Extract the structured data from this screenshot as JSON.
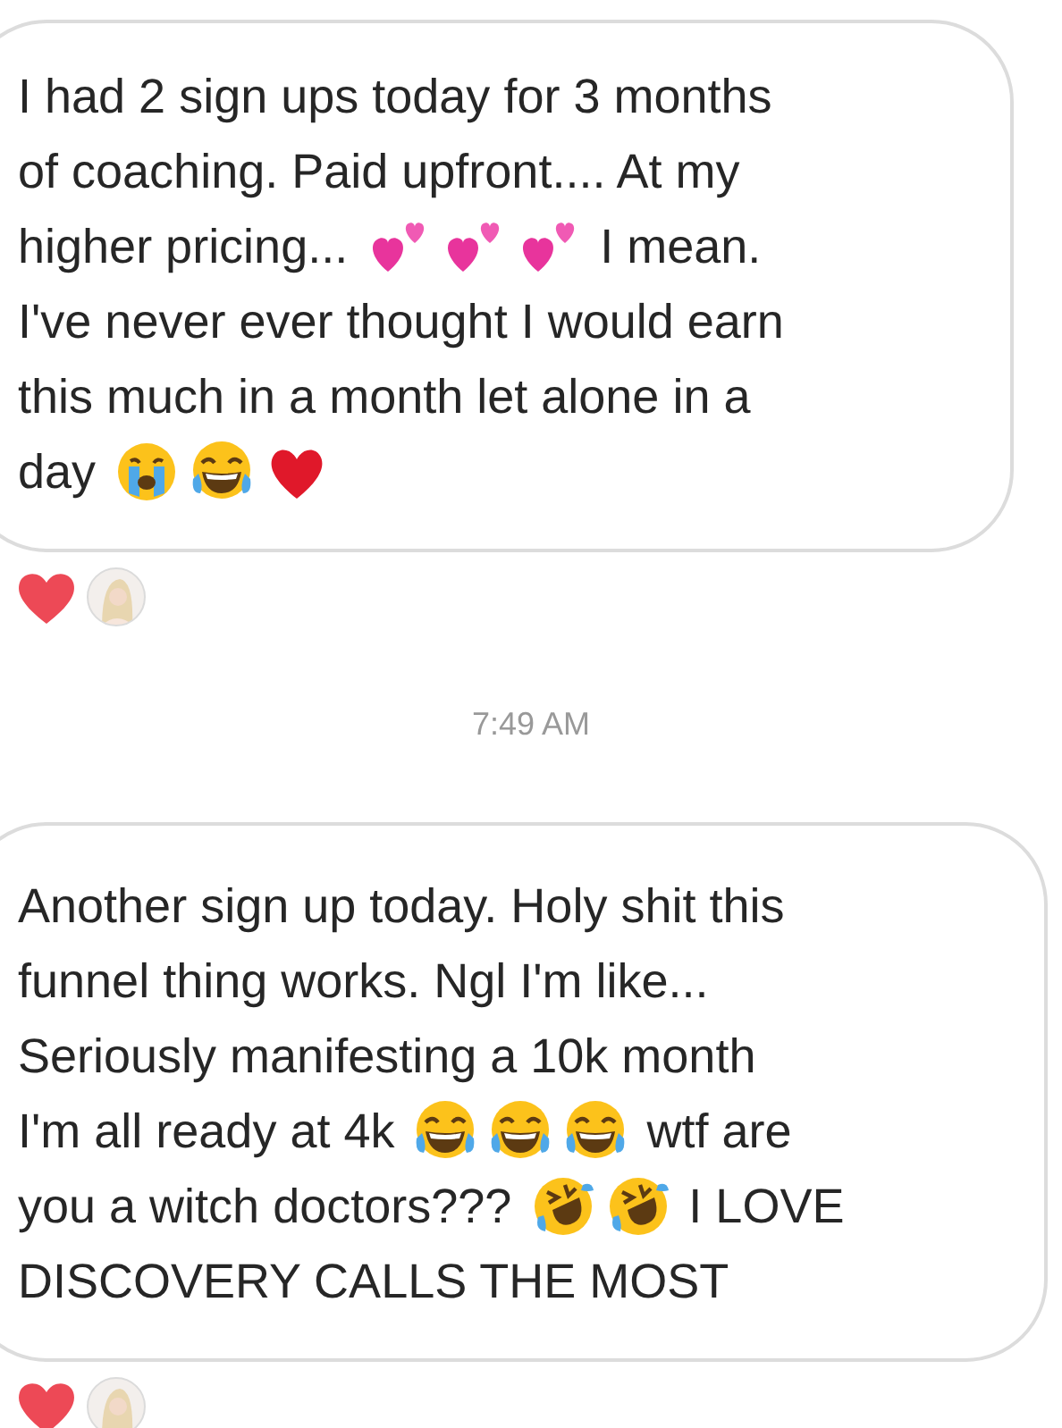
{
  "messages": [
    {
      "lines": [
        [
          {
            "kind": "text",
            "text": "I had 2 sign ups today for 3 months"
          }
        ],
        [
          {
            "kind": "text",
            "text": "of coaching. Paid upfront.... At my"
          }
        ],
        [
          {
            "kind": "text",
            "text": "higher pricing... "
          },
          {
            "kind": "two-hearts"
          },
          {
            "kind": "two-hearts"
          },
          {
            "kind": "two-hearts"
          },
          {
            "kind": "text",
            "text": " I mean."
          }
        ],
        [
          {
            "kind": "text",
            "text": "I've never ever thought I would earn"
          }
        ],
        [
          {
            "kind": "text",
            "text": "this much in a month let alone in a"
          }
        ],
        [
          {
            "kind": "text",
            "text": "day "
          },
          {
            "kind": "crying"
          },
          {
            "kind": "laughing"
          },
          {
            "kind": "heart"
          }
        ]
      ],
      "reaction": {
        "kind": "heart"
      }
    },
    {
      "timestamp": "7:49 AM"
    },
    {
      "lines": [
        [
          {
            "kind": "text",
            "text": "Another sign up today. Holy shit this"
          }
        ],
        [
          {
            "kind": "text",
            "text": "funnel thing works. Ngl I'm like..."
          }
        ],
        [
          {
            "kind": "text",
            "text": "Seriously manifesting a 10k month"
          }
        ],
        [
          {
            "kind": "text",
            "text": "I'm all ready at 4k "
          },
          {
            "kind": "laughing"
          },
          {
            "kind": "laughing"
          },
          {
            "kind": "laughing"
          },
          {
            "kind": "text",
            "text": " wtf are"
          }
        ],
        [
          {
            "kind": "text",
            "text": "you a witch doctors??? "
          },
          {
            "kind": "rofl"
          },
          {
            "kind": "rofl"
          },
          {
            "kind": "text",
            "text": " I LOVE"
          }
        ],
        [
          {
            "kind": "text",
            "text": "DISCOVERY CALLS THE MOST"
          }
        ]
      ],
      "reaction": {
        "kind": "heart"
      }
    }
  ]
}
